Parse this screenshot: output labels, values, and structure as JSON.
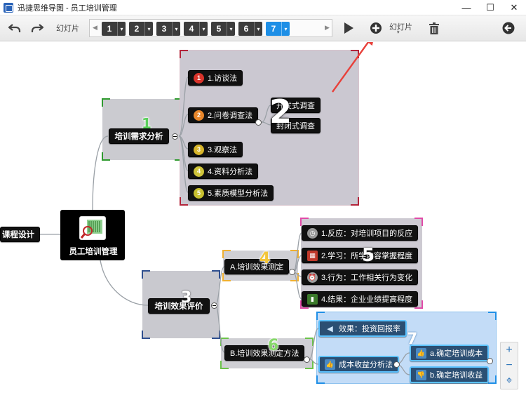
{
  "window": {
    "title": "迅捷思维导图 - 员工培训管理",
    "minimize": "—",
    "maximize": "☐",
    "close": "✕"
  },
  "toolbar": {
    "undo_icon": "undo-icon",
    "redo_icon": "redo-icon",
    "slides_label": "幻灯片",
    "add_slide_label": "幻灯片",
    "strip_left": "◀",
    "strip_right": "▶",
    "slides": [
      {
        "num": "1",
        "dd": "▾"
      },
      {
        "num": "2",
        "dd": "▾"
      },
      {
        "num": "3",
        "dd": "▾"
      },
      {
        "num": "4",
        "dd": "▾"
      },
      {
        "num": "5",
        "dd": "▾"
      },
      {
        "num": "6",
        "dd": "▾"
      },
      {
        "num": "7",
        "dd": "▾"
      }
    ],
    "active_slide": "7"
  },
  "mindmap": {
    "root": "员工培训管理",
    "left_node": "课程设计",
    "branch1": {
      "title": "培训需求分析",
      "items": [
        {
          "label": "1.访谈法",
          "icon_text": "1",
          "color": "#d9342b"
        },
        {
          "label": "2.问卷调查法",
          "icon_text": "2",
          "color": "#e8862a"
        },
        {
          "label": "3.观察法",
          "icon_text": "3",
          "color": "#d7b52a"
        },
        {
          "label": "4.资料分析法",
          "icon_text": "4",
          "color": "#cfc43a"
        },
        {
          "label": "5.素质模型分析法",
          "icon_text": "5",
          "color": "#c8c030"
        }
      ],
      "sub": [
        "开发式调查",
        "封闭式调查"
      ]
    },
    "branch2": {
      "title": "培训效果评价",
      "child_a": "A.培训效果测定",
      "child_b": "B.培训效果测定方法",
      "a_items": [
        "1.反应：对培训项目的反应",
        "2.学习：所学内容掌握程度",
        "3.行为：工作相关行为变化",
        "4.结果：企业业绩提高程度"
      ],
      "b_items": {
        "effect": "效果：投资回报率",
        "cost": "成本收益分析法",
        "cost_a": "a.确定培训成本",
        "cost_b": "b.确定培训收益"
      }
    },
    "frame_numbers": [
      "1",
      "2",
      "3",
      "4",
      "5",
      "6",
      "7"
    ],
    "frame_colors": {
      "f1": "#2f9a2f",
      "f2": "#b3243a",
      "f3": "#2f4f8f",
      "f4": "#f0b030",
      "f5": "#e04aa8",
      "f6": "#6bc34a",
      "f7": "#1f8fe6"
    }
  },
  "zoom": {
    "in": "+",
    "out": "−",
    "fit": "⌖"
  }
}
